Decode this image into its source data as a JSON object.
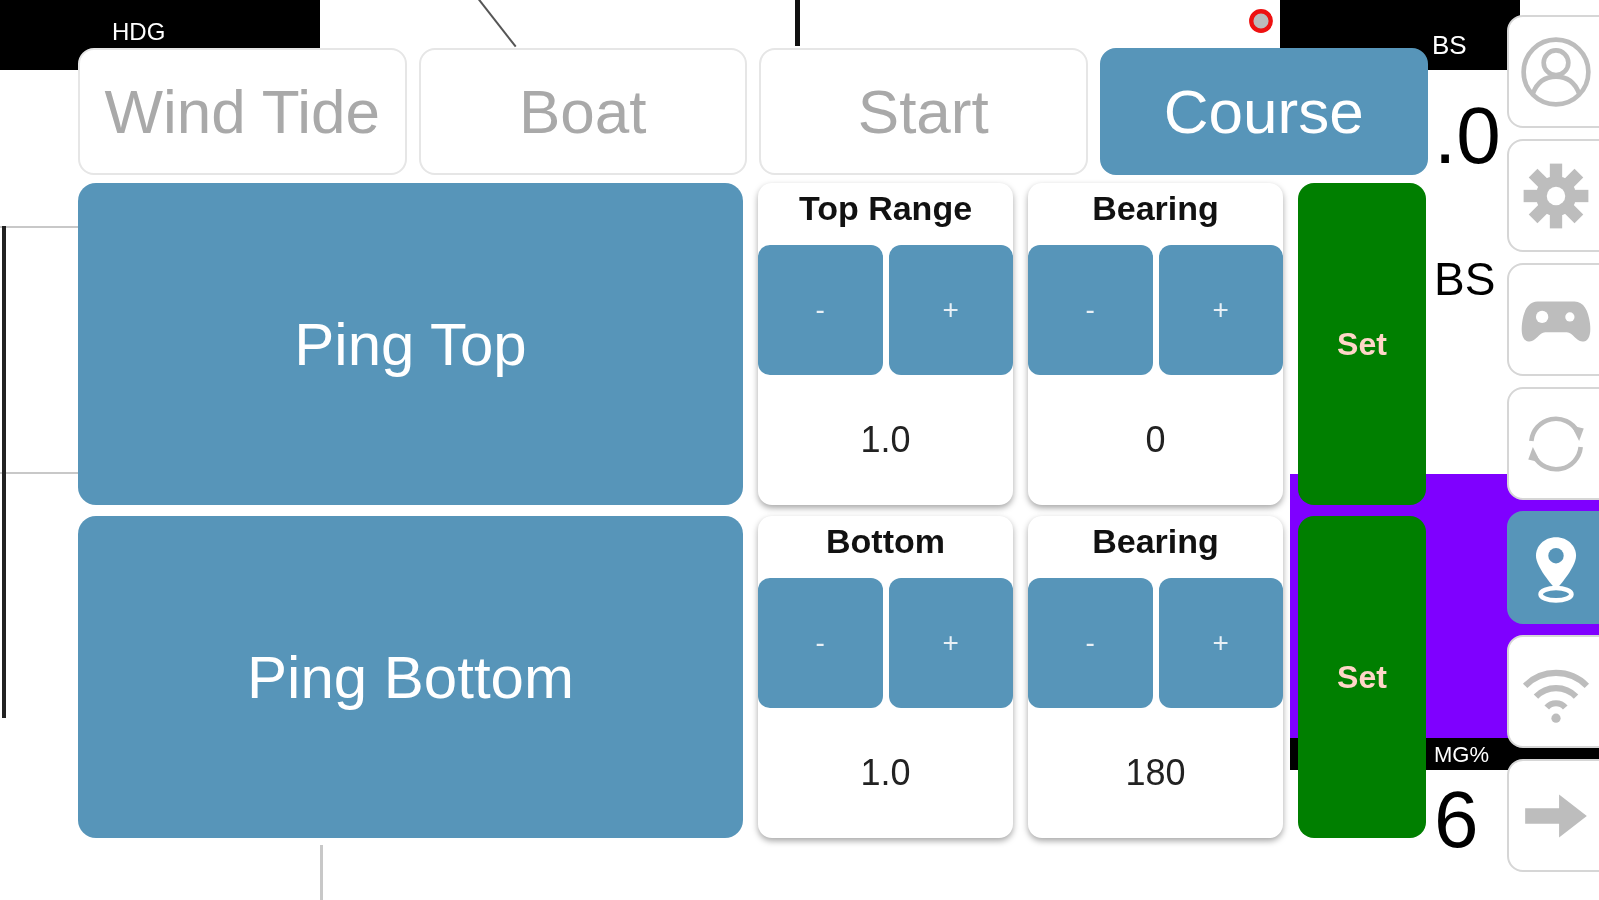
{
  "gauges": [
    {
      "kind": "header",
      "text": "HDG"
    },
    {
      "kind": "header",
      "text": "BS"
    },
    {
      "kind": "value",
      "text": ".0"
    },
    {
      "kind": "label",
      "text": "BS"
    },
    {
      "kind": "header",
      "text": "MG%"
    },
    {
      "kind": "value",
      "text": "6"
    }
  ],
  "tabs": [
    {
      "label": "Wind Tide",
      "selected": false
    },
    {
      "label": "Boat",
      "selected": false
    },
    {
      "label": "Start",
      "selected": false
    },
    {
      "label": "Course",
      "selected": true
    }
  ],
  "ping_buttons": [
    "Ping Top",
    "Ping Bottom"
  ],
  "rows": [
    {
      "controls": [
        {
          "title": "Top Range",
          "minus": "-",
          "plus": "+",
          "value": "1.0"
        },
        {
          "title": "Bearing",
          "minus": "-",
          "plus": "+",
          "value": "0"
        }
      ],
      "set": "Set"
    },
    {
      "controls": [
        {
          "title": "Bottom",
          "minus": "-",
          "plus": "+",
          "value": "1.0"
        },
        {
          "title": "Bearing",
          "minus": "-",
          "plus": "+",
          "value": "180"
        }
      ],
      "set": "Set"
    }
  ],
  "side_buttons": [
    {
      "selected": false
    },
    {
      "selected": false
    },
    {
      "selected": false
    },
    {
      "selected": false
    },
    {
      "selected": true
    },
    {
      "selected": false
    },
    {
      "selected": false
    }
  ]
}
